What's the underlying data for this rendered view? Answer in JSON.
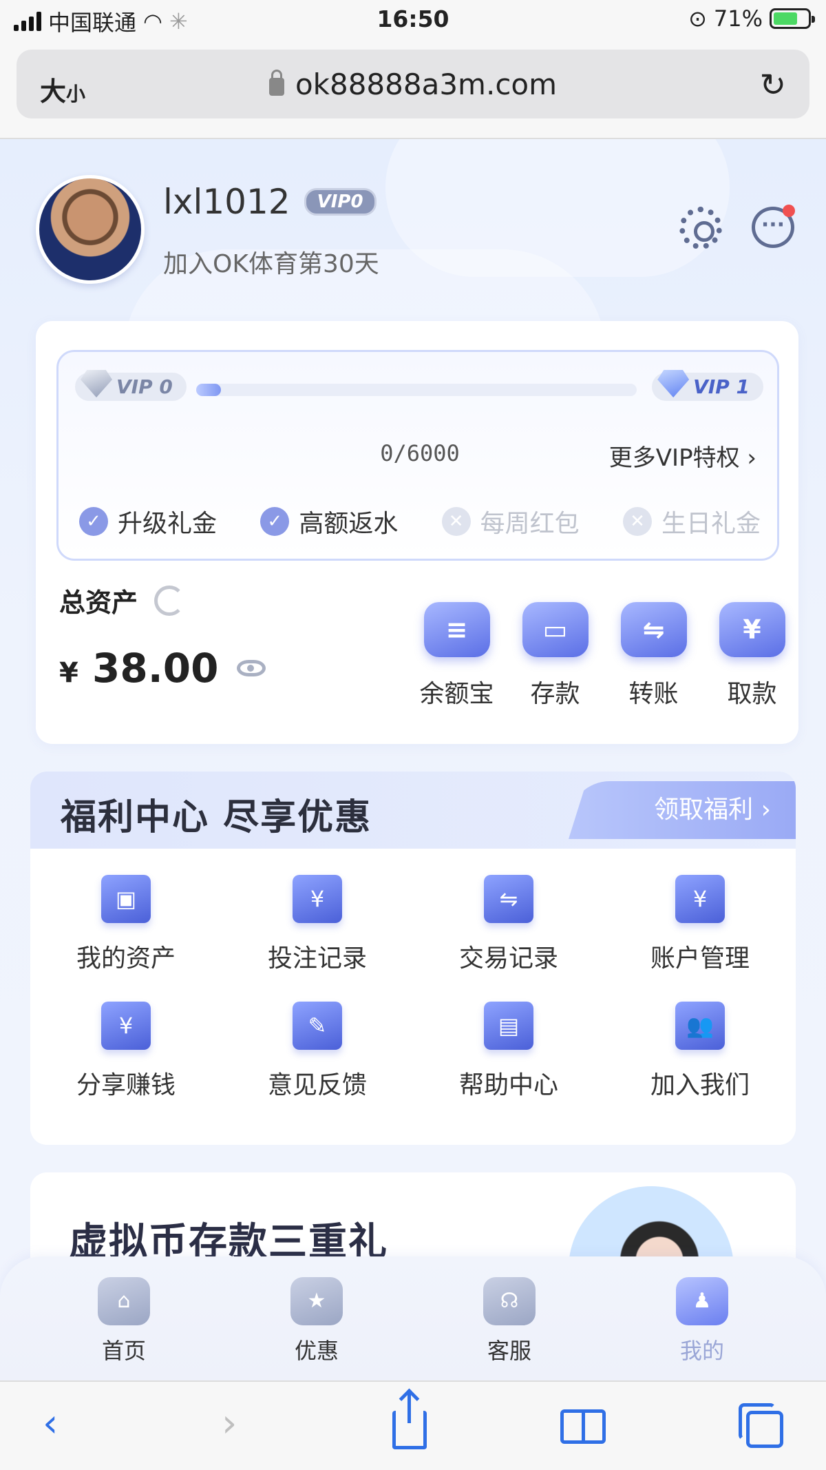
{
  "status_bar": {
    "carrier": "中国联通",
    "time": "16:50",
    "battery": "71%",
    "battery_level": 0.71
  },
  "browser": {
    "text_size_label_big": "大",
    "text_size_label_small": "小",
    "url": "ok88888a3m.com"
  },
  "profile": {
    "username": "lxl1012",
    "vip_badge": "VIP0",
    "join_text": "加入OK体育第30天"
  },
  "vip": {
    "current_level": "VIP 0",
    "next_level": "VIP 1",
    "progress_text": "0/6000",
    "progress_fraction": 0,
    "more_link": "更多VIP特权",
    "perks": [
      {
        "label": "升级礼金",
        "enabled": true
      },
      {
        "label": "高额返水",
        "enabled": true
      },
      {
        "label": "每周红包",
        "enabled": false
      },
      {
        "label": "生日礼金",
        "enabled": false
      }
    ]
  },
  "assets": {
    "label": "总资产",
    "currency": "¥",
    "amount": "38.00",
    "actions": [
      {
        "label": "余额宝",
        "icon": "coin-stack-icon",
        "glyph": "≡"
      },
      {
        "label": "存款",
        "icon": "wallet-card-icon",
        "glyph": "▭"
      },
      {
        "label": "转账",
        "icon": "transfer-icon",
        "glyph": "⇋"
      },
      {
        "label": "取款",
        "icon": "withdraw-yen-icon",
        "glyph": "¥"
      }
    ]
  },
  "welfare": {
    "title": "福利中心  尽享优惠",
    "button": "领取福利",
    "items": [
      {
        "label": "我的资产",
        "icon": "wallet-icon",
        "glyph": "▣"
      },
      {
        "label": "投注记录",
        "icon": "bet-record-icon",
        "glyph": "¥"
      },
      {
        "label": "交易记录",
        "icon": "clipboard-transfer-icon",
        "glyph": "⇋"
      },
      {
        "label": "账户管理",
        "icon": "folder-yen-icon",
        "glyph": "¥"
      },
      {
        "label": "分享赚钱",
        "icon": "hand-coin-icon",
        "glyph": "¥"
      },
      {
        "label": "意见反馈",
        "icon": "feedback-edit-icon",
        "glyph": "✎"
      },
      {
        "label": "帮助中心",
        "icon": "help-book-icon",
        "glyph": "▤"
      },
      {
        "label": "加入我们",
        "icon": "people-icon",
        "glyph": "👥"
      }
    ]
  },
  "promo": {
    "title": "虚拟币存款三重礼"
  },
  "tabbar": {
    "items": [
      {
        "label": "首页",
        "icon": "home-icon",
        "glyph": "⌂",
        "active": false
      },
      {
        "label": "优惠",
        "icon": "gift-star-icon",
        "glyph": "★",
        "active": false
      },
      {
        "label": "客服",
        "icon": "headset-icon",
        "glyph": "☊",
        "active": false
      },
      {
        "label": "我的",
        "icon": "user-tie-icon",
        "glyph": "♟",
        "active": true
      }
    ]
  },
  "colors": {
    "accent": "#6b7ff0",
    "browser_blue": "#2f6fe6",
    "notification_dot": "#f05050"
  }
}
